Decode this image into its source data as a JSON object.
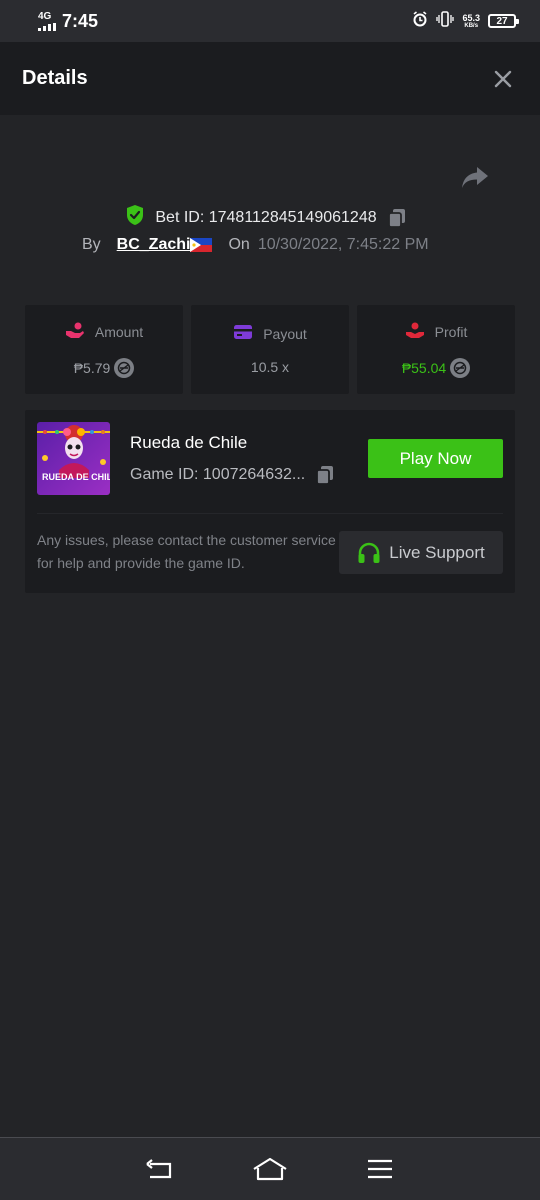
{
  "status_bar": {
    "network": "4G",
    "time": "7:45",
    "speed_value": "65.3",
    "speed_unit": "KB/s",
    "battery": "27"
  },
  "header": {
    "title": "Details"
  },
  "bet": {
    "id_text": "Bet ID: 1748112845149061248",
    "by_label": "By",
    "username": "BC_Zachi",
    "on_label": "On",
    "date": "10/30/2022, 7:45:22 PM"
  },
  "stats": [
    {
      "label": "Amount",
      "value": "₱5.79",
      "icon": "amount-hand-icon",
      "color": "#e8336d"
    },
    {
      "label": "Payout",
      "value": "10.5 x",
      "icon": "payout-card-icon",
      "color": "#7e3bd8"
    },
    {
      "label": "Profit",
      "value": "₱55.04",
      "icon": "profit-hand-icon",
      "color": "#e0283a"
    }
  ],
  "game": {
    "name": "Rueda de Chile",
    "id_text": "Game ID: 1007264632...",
    "play_label": "Play Now",
    "thumb_title": "RUEDA DE CHILE",
    "contact_text": "Any issues, please contact the customer service for help and provide the game ID.",
    "support_label": "Live Support"
  },
  "colors": {
    "accent_green": "#3bc117",
    "background": "#232427",
    "panel": "#1b1c1f"
  }
}
